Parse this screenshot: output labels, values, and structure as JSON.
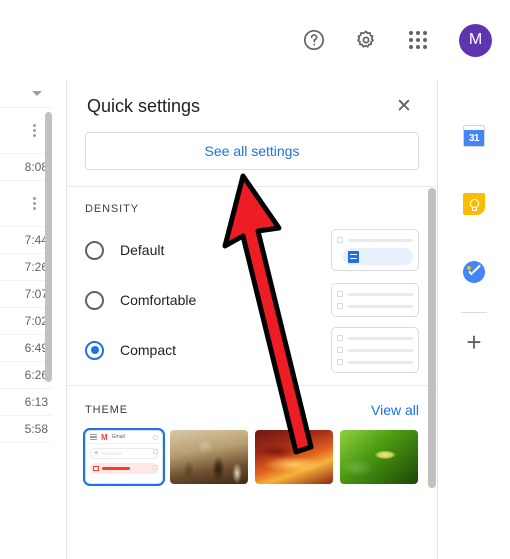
{
  "topbar": {
    "help_icon": "help-circle-icon",
    "settings_icon": "gear-icon",
    "apps_icon": "apps-grid-icon",
    "avatar_initial": "M",
    "avatar_color": "#5e35b1"
  },
  "mail_list": {
    "caret_icon": "chevron-down-icon",
    "rows": [
      {
        "time": "",
        "kebab": true
      },
      {
        "time": "8:08",
        "kebab": false
      },
      {
        "time": "",
        "kebab": true
      },
      {
        "time": "7:44",
        "kebab": false
      },
      {
        "time": "7:26",
        "kebab": false
      },
      {
        "time": "7:07",
        "kebab": false
      },
      {
        "time": "7:02",
        "kebab": false
      },
      {
        "time": "6:49",
        "kebab": false
      },
      {
        "time": "6:26",
        "kebab": false
      },
      {
        "time": "6:13",
        "kebab": false
      },
      {
        "time": "5:58",
        "kebab": false
      }
    ]
  },
  "panel": {
    "title": "Quick settings",
    "close_icon": "close-icon",
    "see_all_settings_label": "See all settings",
    "density": {
      "label": "DENSITY",
      "options": [
        {
          "label": "Default",
          "selected": false
        },
        {
          "label": "Comfortable",
          "selected": false
        },
        {
          "label": "Compact",
          "selected": true
        }
      ]
    },
    "theme": {
      "label": "THEME",
      "view_all_label": "View all",
      "thumbnails": [
        {
          "name": "gmail-light-theme",
          "selected": true
        },
        {
          "name": "chess-theme",
          "selected": false
        },
        {
          "name": "canyon-theme",
          "selected": false
        },
        {
          "name": "leaf-theme",
          "selected": false
        }
      ],
      "mini_preview": {
        "brand_initial": "M",
        "brand_label": "Gmail"
      }
    }
  },
  "right_rail": {
    "items": [
      {
        "name": "google-calendar-icon",
        "label": "31"
      },
      {
        "name": "google-keep-icon",
        "label": ""
      },
      {
        "name": "google-tasks-icon",
        "label": ""
      }
    ],
    "add_label": "+"
  },
  "annotation": {
    "type": "red-arrow",
    "color": "#ee1c25",
    "outline": "#000000",
    "points_to": "See all settings"
  }
}
